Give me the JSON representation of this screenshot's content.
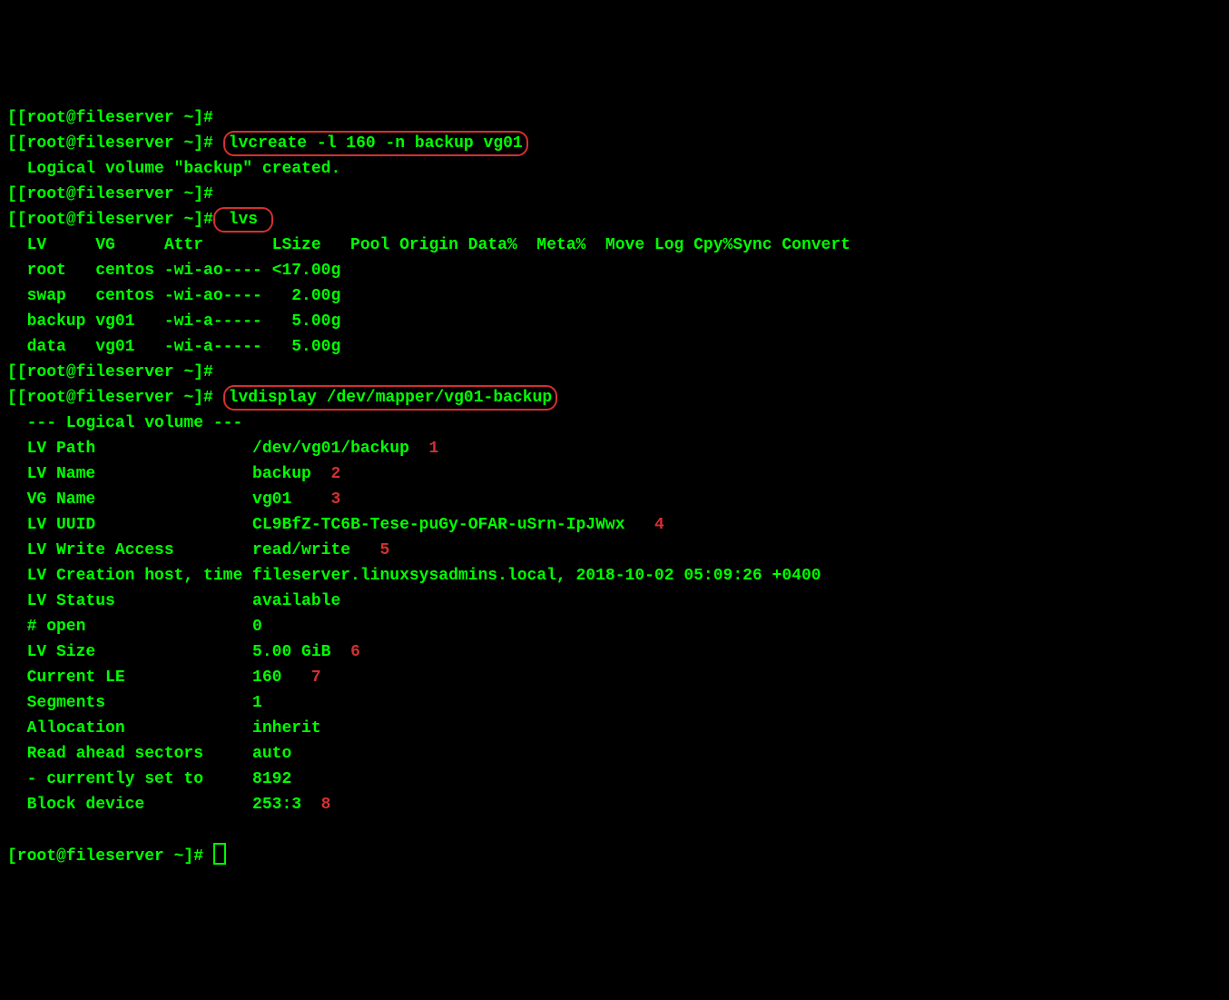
{
  "prompts": {
    "p1": "[root@fileserver ~]#",
    "p2": "[root@fileserver ~]#",
    "p3": "[root@fileserver ~]#",
    "p4": "[root@fileserver ~]#",
    "p5": "[root@fileserver ~]#",
    "p6": "[root@fileserver ~]#",
    "p7": "[root@fileserver ~]#",
    "bracket": "["
  },
  "commands": {
    "lvcreate": "lvcreate -l 160 -n backup vg01",
    "lvs": "lvs",
    "lvdisplay": "lvdisplay /dev/mapper/vg01-backup"
  },
  "output": {
    "created": "  Logical volume \"backup\" created.",
    "lvs_header": "  LV     VG     Attr       LSize   Pool Origin Data%  Meta%  Move Log Cpy%Sync Convert",
    "lvs_rows": {
      "root": "  root   centos -wi-ao---- <17.00g",
      "swap": "  swap   centos -wi-ao----   2.00g",
      "backup": "  backup vg01   -wi-a-----   5.00g",
      "data": "  data   vg01   -wi-a-----   5.00g"
    },
    "lvdisplay_header": "  --- Logical volume ---",
    "lvdisplay": {
      "lv_path_label": "  LV Path               ",
      "lv_path_value": " /dev/vg01/backup",
      "lv_name_label": "  LV Name               ",
      "lv_name_value": " backup",
      "vg_name_label": "  VG Name               ",
      "vg_name_value": " vg01",
      "lv_uuid_label": "  LV UUID               ",
      "lv_uuid_value": " CL9BfZ-TC6B-Tese-puGy-OFAR-uSrn-IpJWwx",
      "lv_write_label": "  LV Write Access       ",
      "lv_write_value": " read/write",
      "lv_creation_line": "  LV Creation host, time fileserver.linuxsysadmins.local, 2018-10-02 05:09:26 +0400",
      "lv_status_label": "  LV Status             ",
      "lv_status_value": " available",
      "open_label": "  # open                ",
      "open_value": " 0",
      "lv_size_label": "  LV Size               ",
      "lv_size_value": " 5.00 GiB",
      "current_le_label": "  Current LE            ",
      "current_le_value": " 160",
      "segments_label": "  Segments              ",
      "segments_value": " 1",
      "allocation_label": "  Allocation            ",
      "allocation_value": " inherit",
      "read_ahead_label": "  Read ahead sectors    ",
      "read_ahead_value": " auto",
      "currently_set_label": "  - currently set to    ",
      "currently_set_value": " 8192",
      "block_device_label": "  Block device          ",
      "block_device_value": " 253:3"
    }
  },
  "annotations": {
    "n1": "1",
    "n2": "2",
    "n3": "3",
    "n4": "4",
    "n5": "5",
    "n6": "6",
    "n7": "7",
    "n8": "8"
  }
}
